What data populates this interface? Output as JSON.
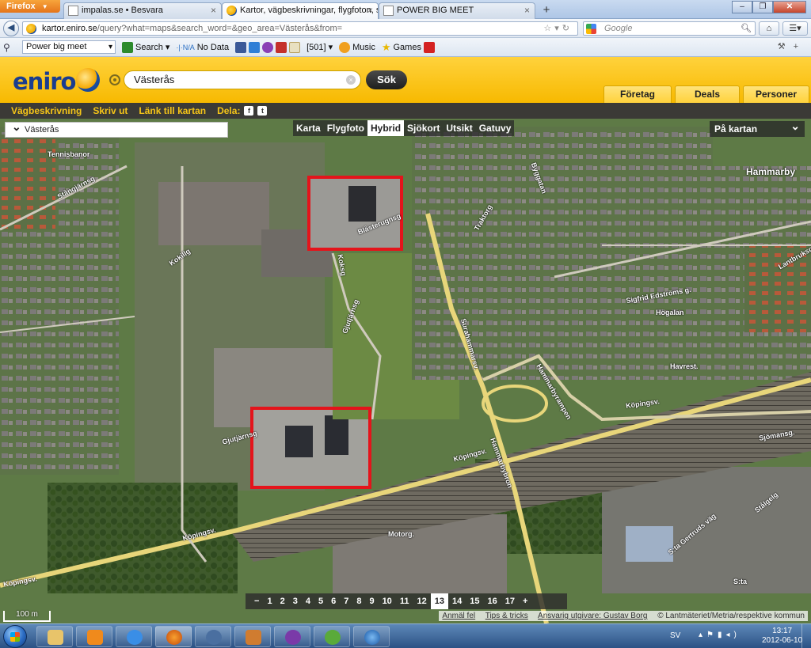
{
  "browser": {
    "menu_button": "Firefox",
    "tabs": [
      {
        "title": "impalas.se • Besvara",
        "active": false
      },
      {
        "title": "Kartor, vägbeskrivningar, flygfoton, sj...",
        "active": true
      },
      {
        "title": "POWER BIG MEET",
        "active": false
      }
    ],
    "new_tab": "+",
    "url_host": "kartor.eniro.se",
    "url_rest": "/query?what=maps&search_word=&geo_area=Västerås&from=",
    "google_placeholder": "Google",
    "toolbar": {
      "search_select": "Power big meet",
      "search_label": "Search",
      "nodata_label": "No Data",
      "count_label": "[501]",
      "music_label": "Music",
      "games_label": "Games"
    }
  },
  "eniro": {
    "logo": "eniro",
    "search_value": "Västerås",
    "search_button": "Sök",
    "tabs": [
      "Företag",
      "Deals",
      "Personer"
    ],
    "links": [
      "Vägbeskrivning",
      "Skriv ut",
      "Länk till kartan"
    ],
    "share_label": "Dela:",
    "location_dropdown": "Västerås",
    "map_types": [
      {
        "label": "Karta",
        "selected": false
      },
      {
        "label": "Flygfoto",
        "selected": false
      },
      {
        "label": "Hybrid",
        "selected": true
      },
      {
        "label": "Sjökort",
        "selected": false
      },
      {
        "label": "Utsikt",
        "selected": false
      },
      {
        "label": "Gatuvy",
        "selected": false
      }
    ],
    "on_map_label": "På kartan",
    "zoom_levels": [
      "−",
      "1",
      "2",
      "3",
      "4",
      "5",
      "6",
      "7",
      "8",
      "9",
      "10",
      "11",
      "12",
      "13",
      "14",
      "15",
      "16",
      "17",
      "+"
    ],
    "zoom_selected": "13",
    "scale_label": "100 m",
    "credits": [
      "Anmäl fel",
      "Tips & tricks",
      "Ansvarig utgivare: Gustav Borg",
      "© Lantmäteriet/Metria/respektive kommun"
    ],
    "map_labels": {
      "hammarby": "Hammarby",
      "tennisbanor": "Tennisbanor",
      "stangjarnsg": "Stångjärnsg",
      "kokillg": "Kokillg",
      "blasterugnsg": "Blåsterugnsg",
      "koksg": "Koksg",
      "gjutjarnsg": "Gjutjärnsg",
      "gjutjarnsg2": "Gjutjärnsg",
      "surahammarsv": "Surahammarsv.",
      "hammarbyrampen": "Hammarbyrampen",
      "hammarbybron": "Hammarbybron",
      "kopingsv1": "Köpingsv.",
      "kopingsv2": "Köpingsv.",
      "kopingsv3": "Köpingsv.",
      "kopingsv4": "Köpingsv.",
      "sigfrid": "Sigfrid Edströms g.",
      "hogalan": "Högalan",
      "havrest": "Havrest.",
      "sjomansg": "Sjömansg.",
      "motorg": "Motorg.",
      "stagelg": "Stålgelg",
      "sta": "S:ta",
      "sta_gertrud": "S:ta Gertruds väg",
      "byggatan": "Byggatan",
      "traktorg": "Traktorg",
      "lantbruksg": "Lantbruksg."
    }
  },
  "taskbar": {
    "lang": "SV",
    "time": "13:17",
    "date": "2012-06-10"
  },
  "colors": {
    "eniro_yellow": "#ffd23c",
    "highlight_red": "#e4141b",
    "eniro_blue": "#1a3d8f"
  }
}
